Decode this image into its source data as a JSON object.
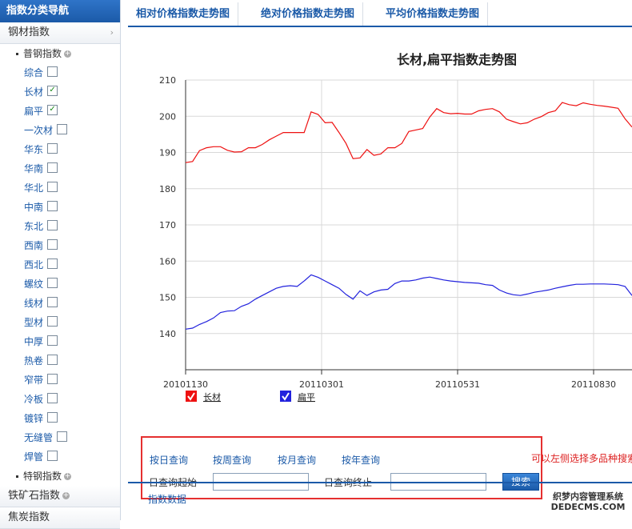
{
  "sidebar": {
    "header": "指数分类导航",
    "category_steel": "钢材指数",
    "sub_common": "普钢指数",
    "items": [
      {
        "label": "综合",
        "checked": false
      },
      {
        "label": "长材",
        "checked": true
      },
      {
        "label": "扁平",
        "checked": true
      },
      {
        "label": "一次材",
        "checked": false
      },
      {
        "label": "华东",
        "checked": false
      },
      {
        "label": "华南",
        "checked": false
      },
      {
        "label": "华北",
        "checked": false
      },
      {
        "label": "中南",
        "checked": false
      },
      {
        "label": "东北",
        "checked": false
      },
      {
        "label": "西南",
        "checked": false
      },
      {
        "label": "西北",
        "checked": false
      },
      {
        "label": "螺纹",
        "checked": false
      },
      {
        "label": "线材",
        "checked": false
      },
      {
        "label": "型材",
        "checked": false
      },
      {
        "label": "中厚",
        "checked": false
      },
      {
        "label": "热卷",
        "checked": false
      },
      {
        "label": "窄带",
        "checked": false
      },
      {
        "label": "冷板",
        "checked": false
      },
      {
        "label": "镀锌",
        "checked": false
      },
      {
        "label": "无缝管",
        "checked": false
      },
      {
        "label": "焊管",
        "checked": false
      }
    ],
    "sub_special": "特钢指数",
    "category_iron_ore": "铁矿石指数",
    "category_coke": "焦炭指数"
  },
  "tabs": [
    "相对价格指数走势图",
    "绝对价格指数走势图",
    "平均价格指数走势图"
  ],
  "chart_data": {
    "type": "line",
    "title": "长材,扁平指数走势图",
    "ylim": [
      130,
      210
    ],
    "yticks": [
      140,
      150,
      160,
      170,
      180,
      190,
      200,
      210
    ],
    "xticks": [
      "20101130",
      "20110301",
      "20110531",
      "20110830"
    ],
    "grid": true,
    "legend_position": "bottom-left",
    "series": [
      {
        "name": "长材",
        "color": "#ee1111",
        "values": [
          187.2,
          187.5,
          190.5,
          191.3,
          191.6,
          191.6,
          190.6,
          190.1,
          190.2,
          191.3,
          191.3,
          192.2,
          193.5,
          194.5,
          195.5,
          195.5,
          195.5,
          195.5,
          201.2,
          200.5,
          198.2,
          198.3,
          195.5,
          192.5,
          188.3,
          188.5,
          190.8,
          189.2,
          189.6,
          191.3,
          191.3,
          192.5,
          195.8,
          196.2,
          196.6,
          199.8,
          202.1,
          201.0,
          200.7,
          200.8,
          200.6,
          200.6,
          201.5,
          201.9,
          202.1,
          201.2,
          199.2,
          198.5,
          197.9,
          198.2,
          199.2,
          199.9,
          201.0,
          201.5,
          203.8,
          203.2,
          202.9,
          203.7,
          203.3,
          203.0,
          202.8,
          202.5,
          202.2,
          199.3,
          197.0
        ]
      },
      {
        "name": "扁平",
        "color": "#2222dd",
        "values": [
          141.2,
          141.5,
          142.5,
          143.3,
          144.3,
          145.8,
          146.2,
          146.3,
          147.5,
          148.2,
          149.5,
          150.5,
          151.5,
          152.5,
          153.0,
          153.2,
          153.0,
          154.5,
          156.2,
          155.5,
          154.5,
          153.5,
          152.5,
          150.8,
          149.5,
          151.8,
          150.5,
          151.5,
          152.0,
          152.2,
          153.8,
          154.5,
          154.5,
          154.8,
          155.3,
          155.6,
          155.2,
          154.8,
          154.5,
          154.3,
          154.1,
          154.0,
          153.9,
          153.5,
          153.3,
          152.0,
          151.2,
          150.7,
          150.5,
          150.9,
          151.4,
          151.7,
          152.0,
          152.5,
          152.9,
          153.3,
          153.6,
          153.6,
          153.7,
          153.7,
          153.7,
          153.6,
          153.5,
          153.0,
          150.5
        ]
      }
    ]
  },
  "query": {
    "by_day": "按日查询",
    "by_week": "按周查询",
    "by_month": "按月查询",
    "by_year": "按年查询",
    "start_label": "日查询起始",
    "end_label": "日查询终止",
    "start_value": "",
    "end_value": "",
    "search_button": "搜索",
    "hint": "可以左侧选择多品种搜索"
  },
  "bottom": {
    "label": "指数数据",
    "watermark_line1": "织梦内容管理系统",
    "watermark_line2": "DEDECMS.COM"
  },
  "colors": {
    "accent": "#1b5aa8",
    "highlight_border": "#e53030"
  }
}
